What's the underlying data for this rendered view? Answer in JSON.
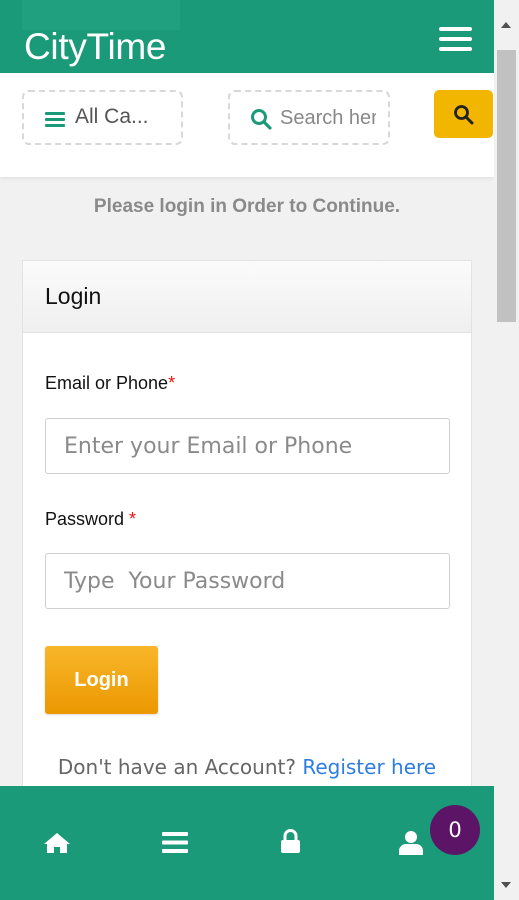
{
  "app": {
    "brand": "CityTime"
  },
  "header": {
    "menu_icon": "hamburger-menu-icon"
  },
  "search_bar": {
    "category_label": "All Ca...",
    "category_icon": "bars-icon",
    "search_placeholder": "Search here",
    "search_icon": "search-icon",
    "search_button_icon": "search-icon"
  },
  "notice": "Please login in Order to Continue.",
  "login_card": {
    "title": "Login",
    "email_label": "Email or Phone",
    "email_required_mark": "*",
    "email_placeholder": "Enter your Email or Phone",
    "password_label": "Password ",
    "password_required_mark": "*",
    "password_placeholder": "Type  Your Password",
    "login_button": "Login",
    "register_prompt": "Don't have an Account? ",
    "register_link": "Register here"
  },
  "bottom_nav": {
    "items": [
      {
        "icon": "home-icon"
      },
      {
        "icon": "menu-icon"
      },
      {
        "icon": "lock-icon"
      },
      {
        "icon": "user-icon"
      }
    ],
    "cart_count": "0"
  },
  "colors": {
    "primary": "#1a9a78",
    "accent": "#f2b600",
    "badge": "#5c1466",
    "link": "#2e7de0",
    "required": "#e11111"
  }
}
